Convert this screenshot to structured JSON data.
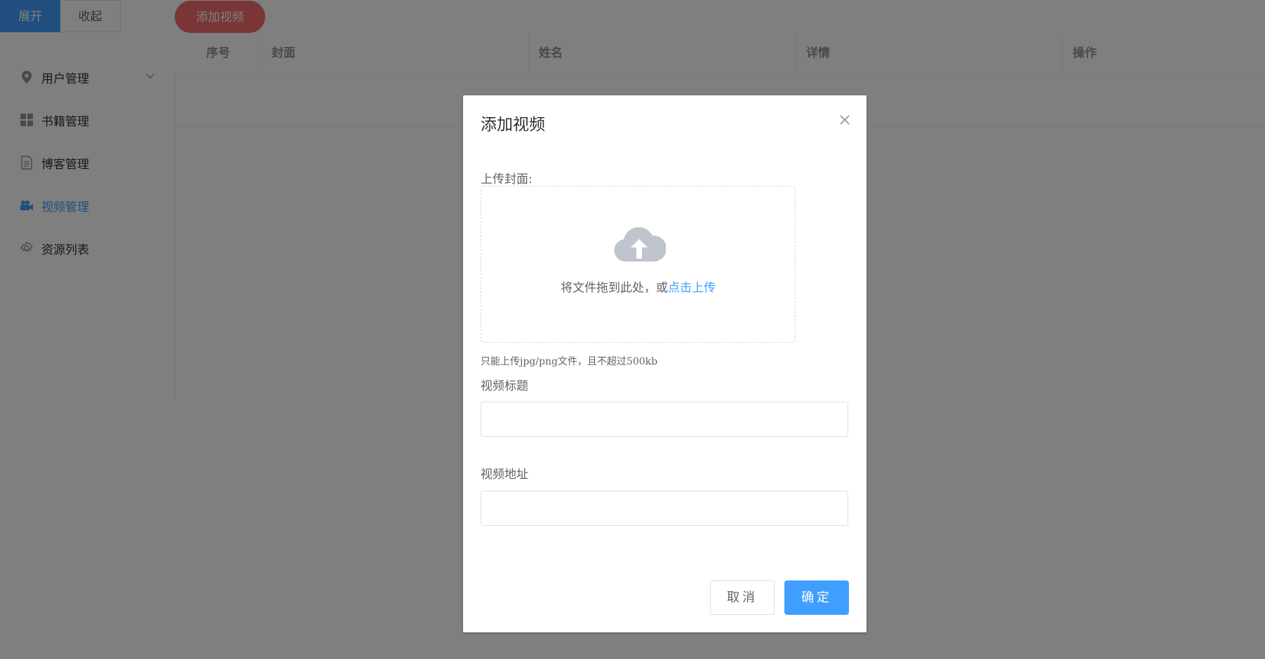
{
  "topbar": {
    "expand_label": "展开",
    "collapse_label": "收起",
    "add_video_label": "添加视频"
  },
  "sidebar": {
    "items": [
      {
        "label": "用户管理",
        "icon": "location-icon",
        "has_submenu": true
      },
      {
        "label": "书籍管理",
        "icon": "grid-icon"
      },
      {
        "label": "博客管理",
        "icon": "document-icon"
      },
      {
        "label": "视频管理",
        "icon": "camera-icon",
        "active": true
      },
      {
        "label": "资源列表",
        "icon": "gear-icon"
      }
    ]
  },
  "table": {
    "columns": [
      "序号",
      "封面",
      "姓名",
      "详情",
      "操作"
    ]
  },
  "dialog": {
    "title": "添加视频",
    "cover_label": "上传封面:",
    "upload_text": "将文件拖到此处，或",
    "upload_link": "点击上传",
    "upload_tip": "只能上传jpg/png文件，且不超过500kb",
    "video_title_label": "视频标题",
    "video_title_value": "",
    "video_url_label": "视频地址",
    "video_url_value": "",
    "cancel_label": "取消",
    "confirm_label": "确定"
  },
  "colors": {
    "primary": "#409eff",
    "danger": "#f56c6c",
    "overlay": "rgba(0,0,0,0.5)"
  }
}
